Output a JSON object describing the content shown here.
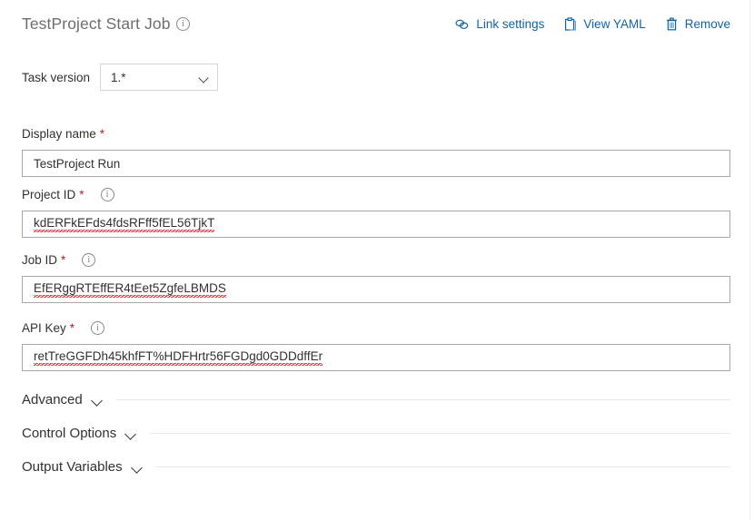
{
  "header": {
    "title": "TestProject Start Job",
    "info_icon": "info-circle-icon",
    "actions": [
      {
        "label": "Link settings",
        "icon": "link-chain-icon"
      },
      {
        "label": "View YAML",
        "icon": "clipboard-icon"
      },
      {
        "label": "Remove",
        "icon": "trash-icon"
      }
    ]
  },
  "task_version": {
    "label": "Task version",
    "value": "1.*",
    "options": [
      "1.*"
    ],
    "chevron_icon": "chevron-down-icon"
  },
  "fields": [
    {
      "name": "display-name",
      "label": "Display name",
      "required": "*",
      "has_info": false,
      "value": "TestProject Run",
      "placeholder": "",
      "spellcheck_underline": false
    },
    {
      "name": "project-id",
      "label": "Project ID",
      "required": "*",
      "has_info": true,
      "info_icon": "info-circle-icon",
      "value": "kdERFkEFds4fdsRFff5fEL56TjkT",
      "placeholder": "",
      "spellcheck_underline": true
    },
    {
      "name": "job-id",
      "label": "Job ID",
      "required": "*",
      "has_info": true,
      "info_icon": "info-circle-icon",
      "value": "EfERggRTEffER4tEet5ZgfeLBMDS",
      "placeholder": "",
      "spellcheck_underline": true
    },
    {
      "name": "api-key",
      "label": "API Key",
      "required": "*",
      "has_info": true,
      "info_icon": "info-circle-icon",
      "value": "retTreGGFDh45khfFT%HDFHrtr56FGDgd0GDDdffEr",
      "value_part1": "retTreGGFDh45khfFT%",
      "value_part2": "HDFHrtr56FGDgd0GDDdffEr",
      "placeholder": "",
      "spellcheck_underline": true
    }
  ],
  "sections": [
    {
      "name": "advanced",
      "label": "Advanced",
      "expanded": false,
      "chevron_icon": "chevron-down-icon"
    },
    {
      "name": "control-options",
      "label": "Control Options",
      "expanded": false,
      "chevron_icon": "chevron-down-icon"
    },
    {
      "name": "output-variables",
      "label": "Output Variables",
      "expanded": false,
      "chevron_icon": "chevron-down-icon"
    }
  ],
  "colors": {
    "link": "#1264a3",
    "required_asterisk": "#a4262c",
    "text": "#323130",
    "title": "#6e6e6e",
    "input_border": "#a7a7a7",
    "rule": "#ebe9e7",
    "spellcheck": "#e81123"
  }
}
